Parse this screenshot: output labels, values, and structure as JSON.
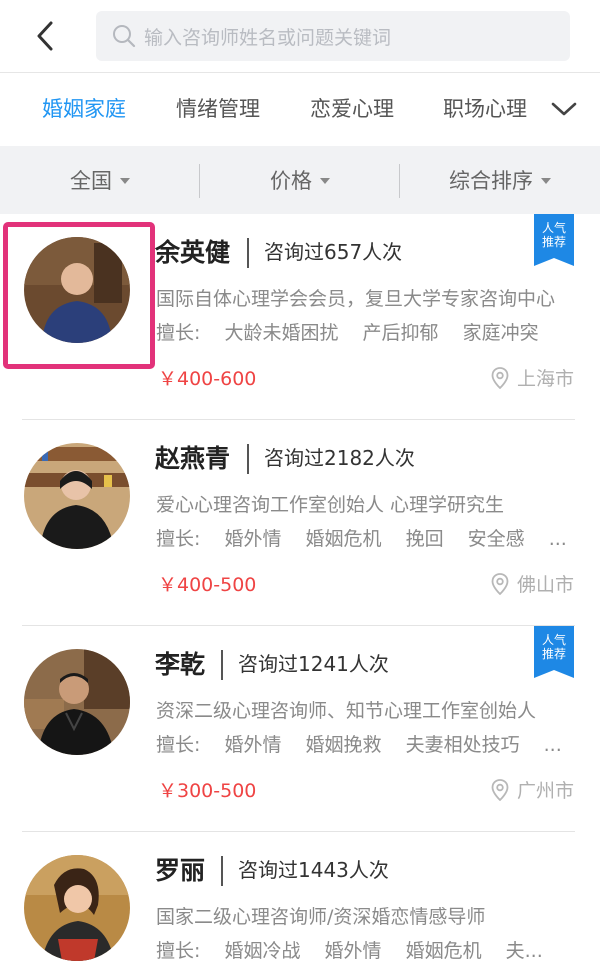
{
  "header": {
    "search_placeholder": "输入咨询师姓名或问题关键词"
  },
  "tabs": [
    {
      "label": "婚姻家庭",
      "active": true
    },
    {
      "label": "情绪管理",
      "active": false
    },
    {
      "label": "恋爱心理",
      "active": false
    },
    {
      "label": "职场心理",
      "active": false
    }
  ],
  "filters": [
    {
      "label": "全国"
    },
    {
      "label": "价格"
    },
    {
      "label": "综合排序"
    }
  ],
  "badge_text": {
    "line1": "人气",
    "line2": "推荐"
  },
  "skills_label": "擅长:",
  "counselors": [
    {
      "name": "余英健",
      "consult_count": "咨询过657人次",
      "intro": "国际自体心理学会会员，复旦大学专家咨询中心",
      "skills": [
        "大龄未婚困扰",
        "产后抑郁",
        "家庭冲突"
      ],
      "price": "￥400-600",
      "location": "上海市",
      "recommended": true,
      "highlighted": true
    },
    {
      "name": "赵燕青",
      "consult_count": "咨询过2182人次",
      "intro": "爱心心理咨询工作室创始人 心理学研究生",
      "skills": [
        "婚外情",
        "婚姻危机",
        "挽回",
        "安全感",
        "..."
      ],
      "price": "￥400-500",
      "location": "佛山市",
      "recommended": false,
      "highlighted": false
    },
    {
      "name": "李乾",
      "consult_count": "咨询过1241人次",
      "intro": "资深二级心理咨询师、知节心理工作室创始人",
      "skills": [
        "婚外情",
        "婚姻挽救",
        "夫妻相处技巧",
        "..."
      ],
      "price": "￥300-500",
      "location": "广州市",
      "recommended": true,
      "highlighted": false
    },
    {
      "name": "罗丽",
      "consult_count": "咨询过1443人次",
      "intro": "国家二级心理咨询师/资深婚恋情感导师",
      "skills": [
        "婚姻冷战",
        "婚外情",
        "婚姻危机",
        "夫..."
      ],
      "price": "",
      "location": "",
      "recommended": false,
      "highlighted": false
    }
  ],
  "colors": {
    "accent": "#2196f3",
    "price": "#ef4444",
    "badge": "#1e88e5",
    "highlight": "#e2327a"
  }
}
